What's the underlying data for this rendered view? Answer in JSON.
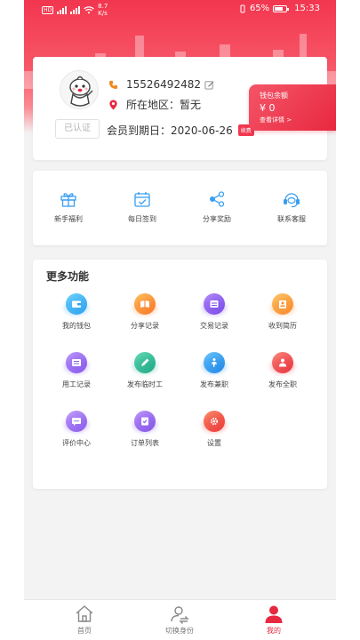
{
  "status_bar": {
    "left_text": "8.7 K/s",
    "battery": "65%",
    "time": "15:33"
  },
  "profile": {
    "phone": "15526492482",
    "region": "所在地区：暂无",
    "verify": "已认证",
    "member_expire": "会员到期日：2020-06-26",
    "renew": "续费"
  },
  "wallet": {
    "title": "钱包余额",
    "amount": "¥ 0",
    "detail": "查看详情 >"
  },
  "quick_actions": [
    {
      "label": "新手福利",
      "icon": "gift-icon"
    },
    {
      "label": "每日签到",
      "icon": "calendar-check-icon"
    },
    {
      "label": "分享奖励",
      "icon": "share-icon"
    },
    {
      "label": "联系客服",
      "icon": "headset-icon"
    }
  ],
  "more": {
    "title": "更多功能",
    "items": [
      {
        "label": "我的钱包",
        "icon": "wallet-icon",
        "color": "#3fb8f5"
      },
      {
        "label": "分享记录",
        "icon": "share-record-icon",
        "color": "#fb9a34"
      },
      {
        "label": "交易记录",
        "icon": "transaction-icon",
        "color": "#8c5ef2"
      },
      {
        "label": "收到简历",
        "icon": "resume-icon",
        "color": "#fba23a"
      },
      {
        "label": "用工记录",
        "icon": "work-record-icon",
        "color": "#9d6af2"
      },
      {
        "label": "发布临时工",
        "icon": "temp-job-icon",
        "color": "#3cc4a2"
      },
      {
        "label": "发布兼职",
        "icon": "part-time-icon",
        "color": "#3aa7f3"
      },
      {
        "label": "发布全职",
        "icon": "full-time-icon",
        "color": "#f2555a"
      },
      {
        "label": "评价中心",
        "icon": "comment-icon",
        "color": "#9f6ef2"
      },
      {
        "label": "订单列表",
        "icon": "order-list-icon",
        "color": "#9a67f0"
      },
      {
        "label": "设置",
        "icon": "settings-icon",
        "color": "#f65a4f"
      }
    ]
  },
  "tabbar": [
    {
      "label": "首页",
      "icon": "home-icon",
      "active": false
    },
    {
      "label": "切换身份",
      "icon": "switch-user-icon",
      "active": false
    },
    {
      "label": "我的",
      "icon": "user-icon",
      "active": true
    }
  ],
  "colors": {
    "primary": "#e8283f",
    "background": "#f3f3f3"
  }
}
